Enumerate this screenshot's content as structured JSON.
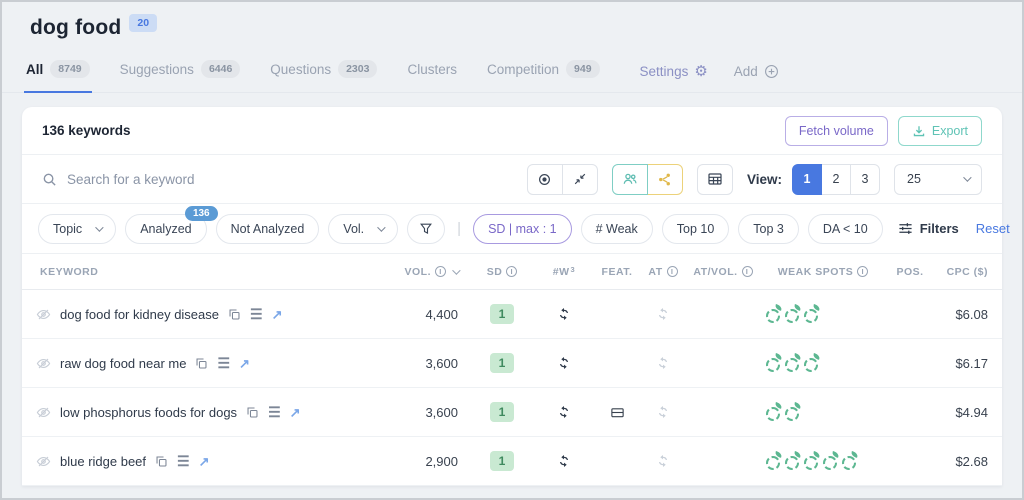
{
  "page": {
    "title": "dog food",
    "count_badge": "20"
  },
  "tabs": {
    "items": [
      {
        "label": "All",
        "badge": "8749",
        "active": true
      },
      {
        "label": "Suggestions",
        "badge": "6446",
        "active": false
      },
      {
        "label": "Questions",
        "badge": "2303",
        "active": false
      },
      {
        "label": "Clusters",
        "badge": "",
        "active": false
      },
      {
        "label": "Competition",
        "badge": "949",
        "active": false
      }
    ],
    "settings_label": "Settings",
    "add_label": "Add"
  },
  "card": {
    "count_label": "136 keywords",
    "fetch_volume_label": "Fetch volume",
    "export_label": "Export"
  },
  "toolbar": {
    "search_placeholder": "Search for a keyword",
    "view_label": "View:",
    "view_options": [
      "1",
      "2",
      "3"
    ],
    "view_active": "1",
    "page_size": "25"
  },
  "filters": {
    "topic_label": "Topic",
    "analyzed_label": "Analyzed",
    "analyzed_badge": "136",
    "not_analyzed_label": "Not Analyzed",
    "vol_label": "Vol.",
    "sd_max_label": "SD | max : 1",
    "quick_filters": [
      "# Weak",
      "Top 10",
      "Top 3",
      "DA < 10"
    ],
    "filters_label": "Filters",
    "reset_label": "Reset"
  },
  "table": {
    "columns": [
      {
        "label": "KEYWORD",
        "align": "l"
      },
      {
        "label": "VOL.",
        "info": true,
        "chevron": true,
        "align": "r"
      },
      {
        "label": "SD",
        "info": true,
        "align": "c"
      },
      {
        "label": "#W",
        "sup": "3",
        "align": "c"
      },
      {
        "label": "FEAT.",
        "align": "c"
      },
      {
        "label": "AT",
        "info": true,
        "align": "c"
      },
      {
        "label": "AT/VOL.",
        "info": true,
        "align": "c"
      },
      {
        "label": "WEAK SPOTS",
        "info": true,
        "align": "c"
      },
      {
        "label": "POS.",
        "align": "c"
      },
      {
        "label": "CPC ($)",
        "align": "r"
      }
    ],
    "rows": [
      {
        "keyword": "dog food for kidney disease",
        "vol": "4,400",
        "sd": "1",
        "w_refresh": true,
        "feat": false,
        "at_refresh": true,
        "at_vol": "",
        "weak_spots": 3,
        "pos": "",
        "cpc": "$6.08"
      },
      {
        "keyword": "raw dog food near me",
        "vol": "3,600",
        "sd": "1",
        "w_refresh": true,
        "feat": false,
        "at_refresh": true,
        "at_vol": "",
        "weak_spots": 3,
        "pos": "",
        "cpc": "$6.17"
      },
      {
        "keyword": "low phosphorus foods for dogs",
        "vol": "3,600",
        "sd": "1",
        "w_refresh": true,
        "feat": true,
        "at_refresh": true,
        "at_vol": "",
        "weak_spots": 2,
        "pos": "",
        "cpc": "$4.94"
      },
      {
        "keyword": "blue ridge beef",
        "vol": "2,900",
        "sd": "1",
        "w_refresh": true,
        "feat": false,
        "at_refresh": true,
        "at_vol": "",
        "weak_spots": 5,
        "pos": "",
        "cpc": "$2.68"
      }
    ]
  },
  "colors": {
    "accent_blue": "#4878e0",
    "fruit_green": "#5cb791",
    "sd_badge_bg": "#c9e9d2",
    "sd_badge_text": "#3f8a5f",
    "purple": "#7a68c8",
    "teal": "#5fc3b5",
    "yellow": "#e0b84a",
    "analyzed_badge_bg": "#5b9bd5"
  }
}
